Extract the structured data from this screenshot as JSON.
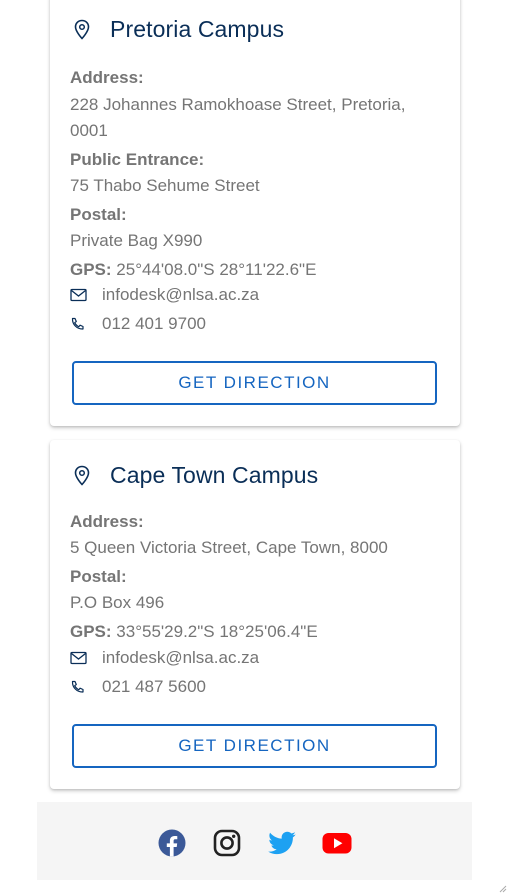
{
  "campuses": [
    {
      "title": "Pretoria Campus",
      "address_label": "Address:",
      "address_line1": "228 Johannes Ramokhoase Street, Pretoria,",
      "address_line2": "0001",
      "entrance_label": "Public Entrance:",
      "entrance_value": "75 Thabo Sehume Street",
      "postal_label": "Postal:",
      "postal_value": "Private Bag X990",
      "gps_label": "GPS:",
      "gps_value": "25°44'08.0\"S 28°11'22.6\"E",
      "email": "infodesk@nlsa.ac.za",
      "phone": "012 401 9700",
      "button_label": "GET DIRECTION"
    },
    {
      "title": "Cape Town Campus",
      "address_label": "Address:",
      "address_line1": "5 Queen Victoria Street, Cape Town, 8000",
      "postal_label": "Postal:",
      "postal_value": "P.O Box 496",
      "gps_label": "GPS:",
      "gps_value": "33°55'29.2\"S 18°25'06.4\"E",
      "email": "infodesk@nlsa.ac.za",
      "phone": "021 487 5600",
      "button_label": "GET DIRECTION"
    }
  ],
  "footer": {
    "social_icons": [
      "facebook-icon",
      "instagram-icon",
      "twitter-icon",
      "youtube-icon"
    ]
  },
  "colors": {
    "title": "#0a2e57",
    "text": "#757575",
    "button_accent": "#1565c0",
    "footer_bg": "#f5f5f5",
    "facebook": "#3b5998",
    "twitter": "#1da1f2",
    "youtube": "#ff0000"
  }
}
